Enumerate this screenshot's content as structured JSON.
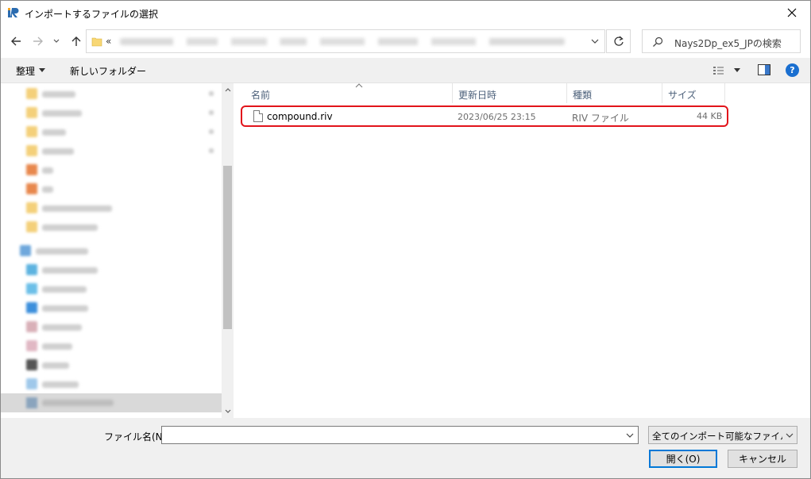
{
  "window": {
    "title": "インポートするファイルの選択",
    "close_glyph": "✕"
  },
  "address": {
    "prefix": "«",
    "path_blurred": true
  },
  "search": {
    "placeholder": "Nays2Dp_ex5_JPの検索"
  },
  "toolbar": {
    "organize_label": "整理",
    "new_folder_label": "新しいフォルダー"
  },
  "columns": {
    "name": "名前",
    "date": "更新日時",
    "type": "種類",
    "size": "サイズ"
  },
  "files": [
    {
      "name": "compound.riv",
      "date": "2023/06/25 23:15",
      "type": "RIV ファイル",
      "size": "44 KB",
      "highlighted": true
    }
  ],
  "bottom": {
    "filename_label": "ファイル名(N):",
    "filename_value": "",
    "filter_value": "全てのインポート可能なファイル (*.tpo",
    "open_label": "開く(O)",
    "cancel_label": "キャンセル"
  },
  "colors": {
    "highlight_border": "#e2141b",
    "accent": "#0078d7",
    "help_blue": "#1a6fd0"
  }
}
